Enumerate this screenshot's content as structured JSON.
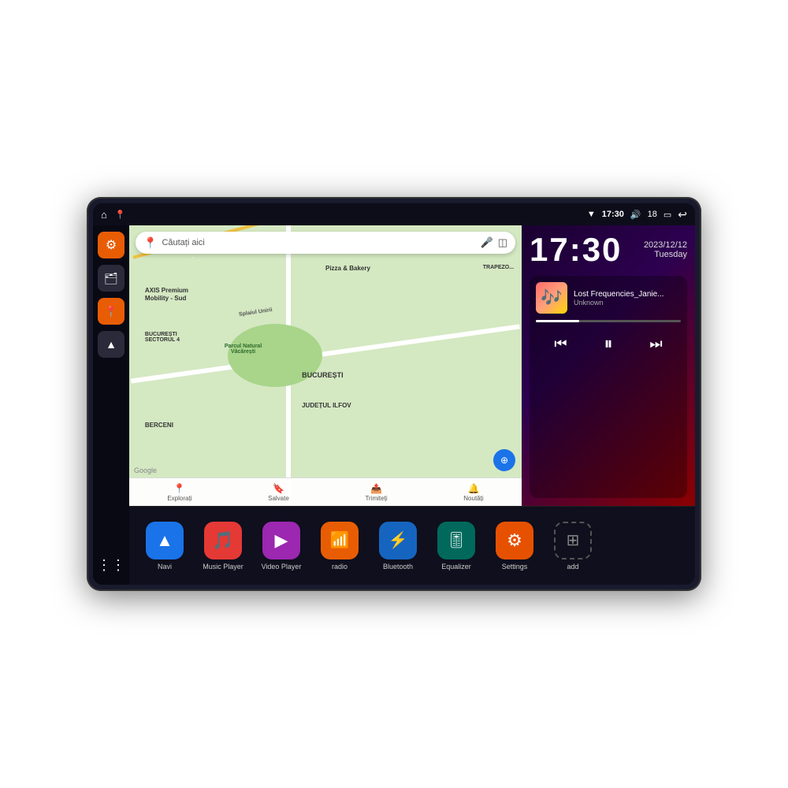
{
  "device": {
    "status_bar": {
      "wifi_icon": "▾",
      "time": "17:30",
      "volume_icon": "🔊",
      "battery_level": "18",
      "battery_icon": "🔋",
      "back_icon": "↩"
    },
    "home_icon": "⌂",
    "map_nav_icon": "📍"
  },
  "sidebar": {
    "settings_icon": "⚙",
    "files_icon": "🗂",
    "maps_icon": "📍",
    "navi_icon": "▶",
    "grid_icon": "⋮⋮"
  },
  "map": {
    "search_placeholder": "Căutați aici",
    "labels": [
      "AXIS Premium Mobility - Sud",
      "Pizza & Bakery",
      "Parcul Natural Văcărești",
      "BUCUREȘTI",
      "JUDEȚUL ILFOV",
      "BUCUREȘTI SECTORUL 4",
      "BERCENI"
    ],
    "nav_items": [
      {
        "icon": "📍",
        "label": "Explorați"
      },
      {
        "icon": "🔖",
        "label": "Salvate"
      },
      {
        "icon": "📤",
        "label": "Trimiteți"
      },
      {
        "icon": "🔔",
        "label": "Noutăți"
      }
    ]
  },
  "clock": {
    "time": "17:30",
    "date": "2023/12/12",
    "day": "Tuesday"
  },
  "music": {
    "track_name": "Lost Frequencies_Janie...",
    "artist": "Unknown",
    "progress_percent": 30
  },
  "apps": [
    {
      "id": "navi",
      "label": "Navi",
      "icon": "▲",
      "color": "blue"
    },
    {
      "id": "music",
      "label": "Music Player",
      "icon": "🎵",
      "color": "red"
    },
    {
      "id": "video",
      "label": "Video Player",
      "icon": "▶",
      "color": "purple"
    },
    {
      "id": "radio",
      "label": "radio",
      "icon": "📻",
      "color": "orange-radio"
    },
    {
      "id": "bluetooth",
      "label": "Bluetooth",
      "icon": "⚡",
      "color": "blue-bt"
    },
    {
      "id": "equalizer",
      "label": "Equalizer",
      "icon": "🎚",
      "color": "teal"
    },
    {
      "id": "settings",
      "label": "Settings",
      "icon": "⚙",
      "color": "orange-set"
    },
    {
      "id": "add",
      "label": "add",
      "icon": "+",
      "color": "add-box"
    }
  ]
}
